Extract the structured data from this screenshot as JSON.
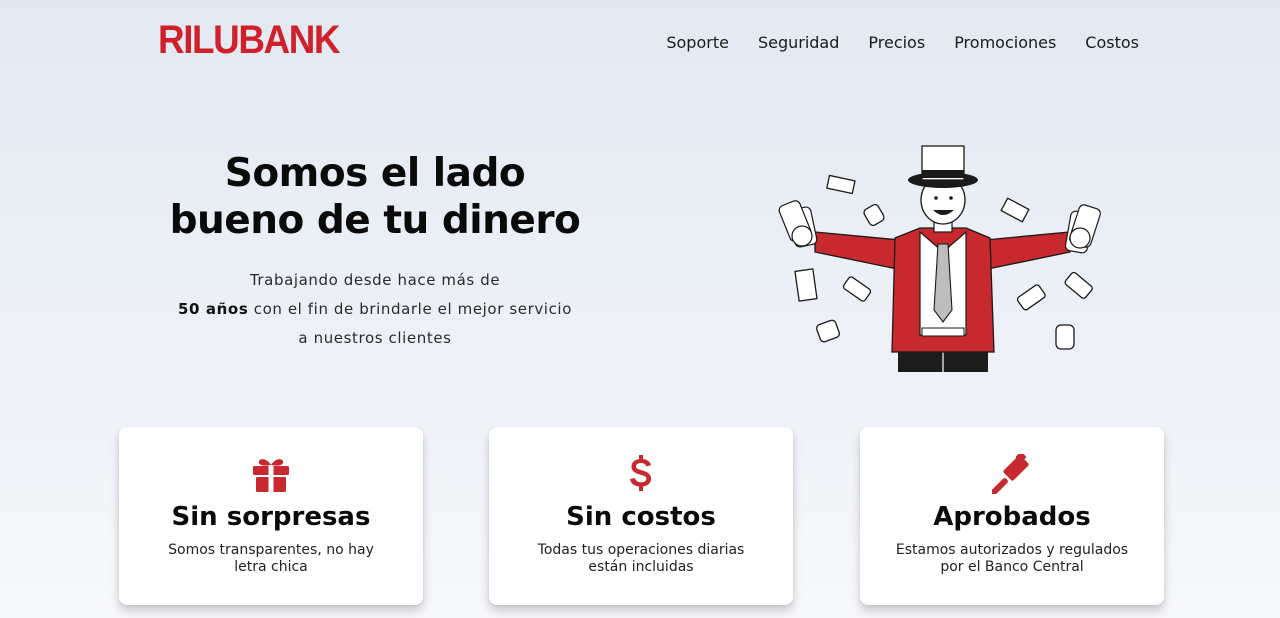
{
  "header": {
    "logo": "RILUBANK",
    "brand_color": "#d0202a",
    "nav": [
      {
        "label": "Soporte"
      },
      {
        "label": "Seguridad"
      },
      {
        "label": "Precios"
      },
      {
        "label": "Promociones"
      },
      {
        "label": "Costos"
      }
    ]
  },
  "hero": {
    "title_line1": "Somos el lado",
    "title_line2": "bueno de tu dinero",
    "text_line1": "Trabajando desde hace más de",
    "text_highlight": "50 años",
    "text_line2_rest": " con el fin de brindarle el mejor servicio",
    "text_line3": "a nuestros clientes",
    "illustration": "man-with-top-hat-holding-money"
  },
  "cards": [
    {
      "icon": "gift-icon",
      "title": "Sin sorpresas",
      "desc_line1": "Somos transparentes, no hay",
      "desc_line2": "letra chica"
    },
    {
      "icon": "dollar-icon",
      "title": "Sin costos",
      "desc_line1": "Todas tus operaciones diarias",
      "desc_line2": "están incluidas"
    },
    {
      "icon": "gavel-icon",
      "title": "Aprobados",
      "desc_line1": "Estamos autorizados y regulados",
      "desc_line2": "por el Banco Central"
    }
  ]
}
